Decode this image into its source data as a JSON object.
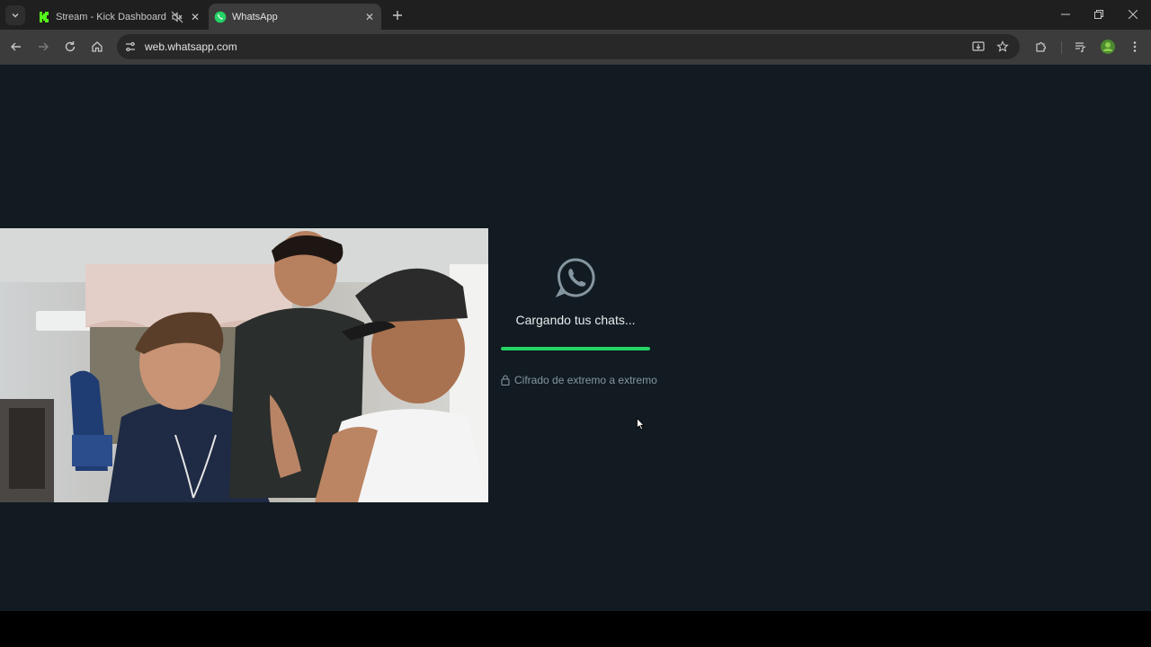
{
  "browser": {
    "tabs": [
      {
        "title": "Stream - Kick Dashboard",
        "favicon": "kick-logo-icon",
        "muted": true,
        "active": false
      },
      {
        "title": "WhatsApp",
        "favicon": "whatsapp-logo-icon",
        "active": true
      }
    ],
    "address": "web.whatsapp.com"
  },
  "whatsapp": {
    "loading_text": "Cargando tus chats...",
    "progress": 1.0,
    "encryption_text": "Cifrado de extremo a extremo",
    "accent_color": "#25d366",
    "background_color": "#111b21"
  },
  "webcam_overlay": {
    "description_icon": "webcam-feed"
  }
}
